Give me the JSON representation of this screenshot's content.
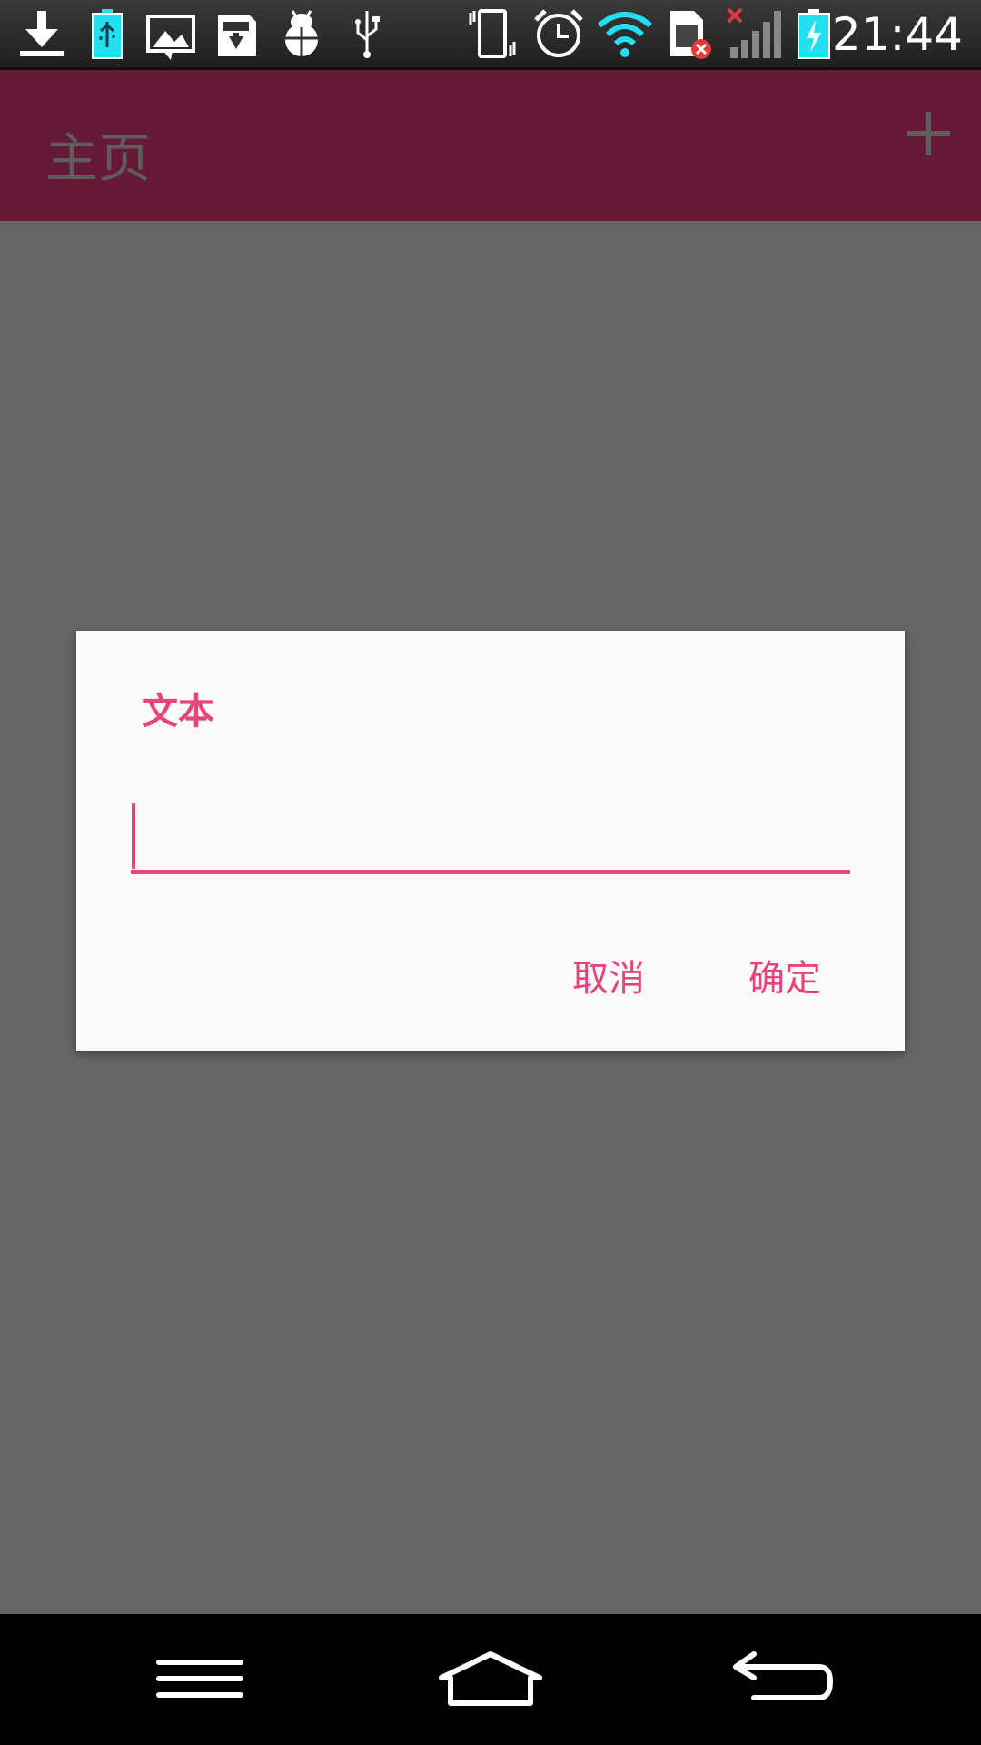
{
  "status_bar": {
    "time": "21:44",
    "icons": [
      "download-icon",
      "usb-battery-icon",
      "image-icon",
      "sd-card-icon",
      "bug-icon",
      "usb-icon",
      "vibrate-icon",
      "alarm-icon",
      "wifi-icon",
      "sim-error-icon",
      "signal-icon",
      "battery-charging-icon"
    ]
  },
  "app_bar": {
    "title": "主页",
    "add_icon": "plus-icon"
  },
  "dialog": {
    "title": "文本",
    "input_value": "",
    "cancel_label": "取消",
    "ok_label": "确定"
  },
  "nav_bar": {
    "icons": [
      "menu-icon",
      "home-icon",
      "back-icon"
    ]
  },
  "colors": {
    "accent": "#e8437a",
    "app_bar": "#661a37",
    "scrim": "#666666",
    "dialog_bg": "#fafafa",
    "icon_cyan": "#22e0f0"
  }
}
